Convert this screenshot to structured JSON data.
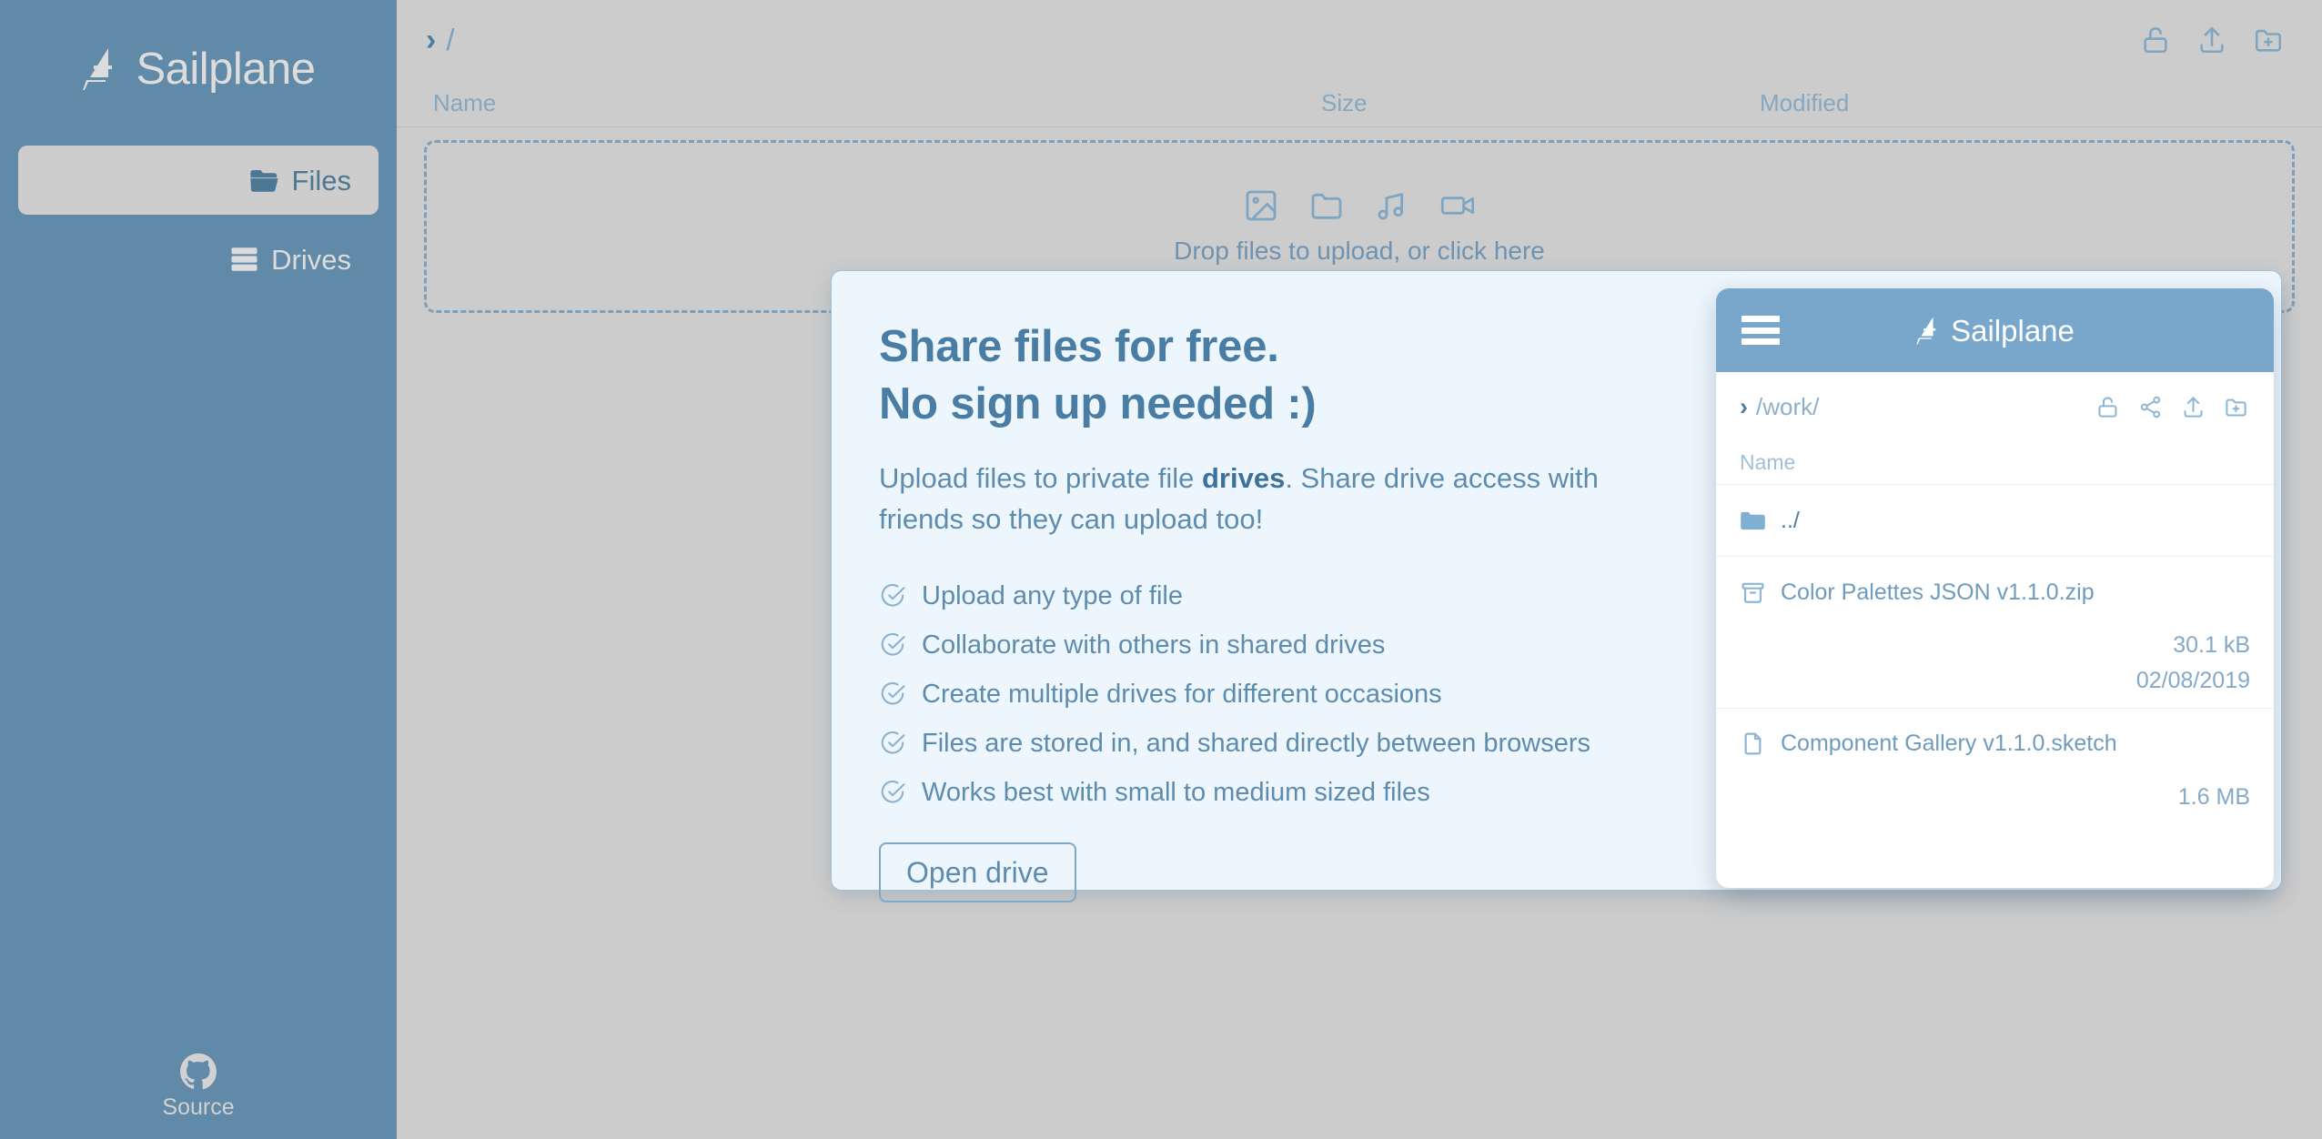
{
  "app": {
    "brand_name": "Sailplane",
    "colors": {
      "sidebar_blue": "#6189a8",
      "accent_blue": "#4a7da3",
      "main_bg": "#cccccc",
      "promo_bg": "#eef6fd",
      "mockup_header": "#78a7cb"
    }
  },
  "sidebar": {
    "items": [
      {
        "label": "Files",
        "icon": "folder-icon",
        "active": true
      },
      {
        "label": "Drives",
        "icon": "drives-icon",
        "active": false
      }
    ],
    "source": {
      "label": "Source",
      "icon": "github-icon"
    }
  },
  "topbar": {
    "breadcrumb": {
      "chevron": "›",
      "path": "/"
    },
    "actions": [
      {
        "name": "unlock-icon",
        "title": "unlock"
      },
      {
        "name": "upload-icon",
        "title": "upload"
      },
      {
        "name": "new-folder-icon",
        "title": "new folder"
      }
    ]
  },
  "file_table": {
    "columns": [
      "Name",
      "Size",
      "Modified"
    ]
  },
  "dropzone": {
    "icons": [
      "image-icon",
      "folder-icon",
      "music-icon",
      "video-icon"
    ],
    "text": "Drop files to upload, or click here"
  },
  "promo": {
    "headline_line1": "Share files for free.",
    "headline_line2": "No sign up needed :)",
    "body_before": "Upload files to private file ",
    "body_bold": "drives",
    "body_after": ". Share drive access with friends so they can upload too!",
    "features": [
      "Upload any type of file",
      "Collaborate with others in shared drives",
      "Create multiple drives for different occasions",
      "Files are stored in, and shared directly between browsers",
      "Works best with small to medium sized files"
    ],
    "cta_label": "Open drive"
  },
  "mockup": {
    "brand_name": "Sailplane",
    "menu_icon": "hamburger-icon",
    "breadcrumb": {
      "chevron": "›",
      "path": "/work/"
    },
    "actions": [
      {
        "name": "unlock-icon"
      },
      {
        "name": "share-icon"
      },
      {
        "name": "upload-icon"
      },
      {
        "name": "new-folder-icon"
      }
    ],
    "column_header": "Name",
    "rows": [
      {
        "name": "../",
        "icon": "folder-filled-icon",
        "size": "",
        "modified": "",
        "is_parent": true
      },
      {
        "name": "Color Palettes JSON v1.1.0.zip",
        "icon": "archive-icon",
        "size": "30.1 kB",
        "modified": "02/08/2019",
        "is_parent": false
      },
      {
        "name": "Component Gallery v1.1.0.sketch",
        "icon": "document-icon",
        "size": "1.6 MB",
        "modified": "",
        "is_parent": false
      }
    ]
  }
}
